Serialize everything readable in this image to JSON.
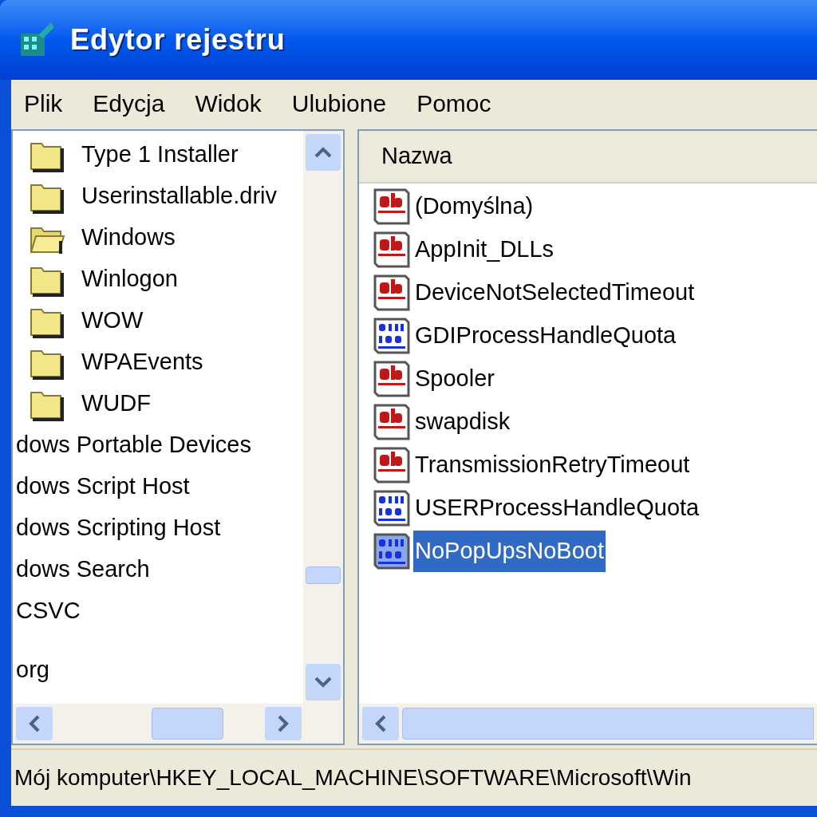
{
  "window": {
    "title": "Edytor rejestru"
  },
  "menu": [
    "Plik",
    "Edycja",
    "Widok",
    "Ulubione",
    "Pomoc"
  ],
  "tree": {
    "items": [
      {
        "label": "Type 1 Installer",
        "kind": "folder"
      },
      {
        "label": "Userinstallable.driv",
        "kind": "folder"
      },
      {
        "label": "Windows",
        "kind": "open_folder"
      },
      {
        "label": "Winlogon",
        "kind": "folder"
      },
      {
        "label": "WOW",
        "kind": "folder"
      },
      {
        "label": "WPAEvents",
        "kind": "folder"
      },
      {
        "label": "WUDF",
        "kind": "folder"
      },
      {
        "label": "dows Portable Devices",
        "kind": "text"
      },
      {
        "label": "dows Script Host",
        "kind": "text"
      },
      {
        "label": "dows Scripting Host",
        "kind": "text"
      },
      {
        "label": "dows Search",
        "kind": "text"
      },
      {
        "label": "CSVC",
        "kind": "text"
      },
      {
        "label": "org",
        "kind": "text"
      }
    ]
  },
  "values": {
    "columns": [
      "Nazwa"
    ],
    "rows": [
      {
        "name": "(Domyślna)",
        "kind": "string",
        "selected": false
      },
      {
        "name": "AppInit_DLLs",
        "kind": "string",
        "selected": false
      },
      {
        "name": "DeviceNotSelectedTimeout",
        "kind": "string",
        "selected": false
      },
      {
        "name": "GDIProcessHandleQuota",
        "kind": "dword",
        "selected": false
      },
      {
        "name": "Spooler",
        "kind": "string",
        "selected": false
      },
      {
        "name": "swapdisk",
        "kind": "string",
        "selected": false
      },
      {
        "name": "TransmissionRetryTimeout",
        "kind": "string",
        "selected": false
      },
      {
        "name": "USERProcessHandleQuota",
        "kind": "dword",
        "selected": false
      },
      {
        "name": "NoPopUpsNoBoot",
        "kind": "dword",
        "selected": true
      }
    ]
  },
  "status_bar": "Mój komputer\\HKEY_LOCAL_MACHINE\\SOFTWARE\\Microsoft\\Win"
}
